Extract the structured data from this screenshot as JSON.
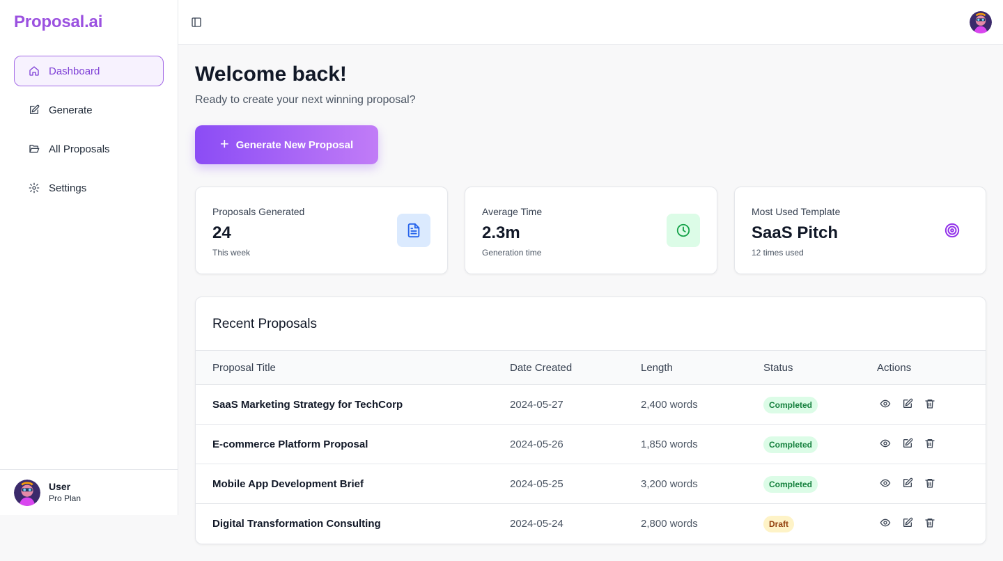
{
  "app": {
    "brand": "Proposal.ai"
  },
  "sidebar": {
    "items": [
      {
        "label": "Dashboard",
        "icon": "home-icon",
        "active": true
      },
      {
        "label": "Generate",
        "icon": "edit-icon",
        "active": false
      },
      {
        "label": "All Proposals",
        "icon": "folder-icon",
        "active": false
      },
      {
        "label": "Settings",
        "icon": "gear-icon",
        "active": false
      }
    ],
    "user": {
      "name": "User",
      "plan": "Pro Plan"
    }
  },
  "header": {
    "toggle_icon": "sidebar-toggle-icon"
  },
  "main": {
    "welcome": "Welcome back!",
    "subtitle": "Ready to create your next winning proposal?",
    "cta_label": "Generate New Proposal",
    "stats": [
      {
        "label": "Proposals Generated",
        "value": "24",
        "sub": "This week",
        "icon": "document-icon",
        "accent": "#2563eb"
      },
      {
        "label": "Average Time",
        "value": "2.3m",
        "sub": "Generation time",
        "icon": "clock-icon",
        "accent": "#16a34a"
      },
      {
        "label": "Most Used Template",
        "value": "SaaS Pitch",
        "sub": "12 times used",
        "icon": "target-icon",
        "accent": "#9333ea"
      }
    ],
    "recent": {
      "title": "Recent Proposals",
      "columns": [
        "Proposal Title",
        "Date Created",
        "Length",
        "Status",
        "Actions"
      ],
      "rows": [
        {
          "title": "SaaS Marketing Strategy for TechCorp",
          "date": "2024-05-27",
          "length": "2,400 words",
          "status": "Completed"
        },
        {
          "title": "E-commerce Platform Proposal",
          "date": "2024-05-26",
          "length": "1,850 words",
          "status": "Completed"
        },
        {
          "title": "Mobile App Development Brief",
          "date": "2024-05-25",
          "length": "3,200 words",
          "status": "Completed"
        },
        {
          "title": "Digital Transformation Consulting",
          "date": "2024-05-24",
          "length": "2,800 words",
          "status": "Draft"
        }
      ]
    }
  },
  "colors": {
    "brand": "#9b51e0",
    "cta_start": "#8b4cf5",
    "cta_end": "#c17cf7"
  }
}
